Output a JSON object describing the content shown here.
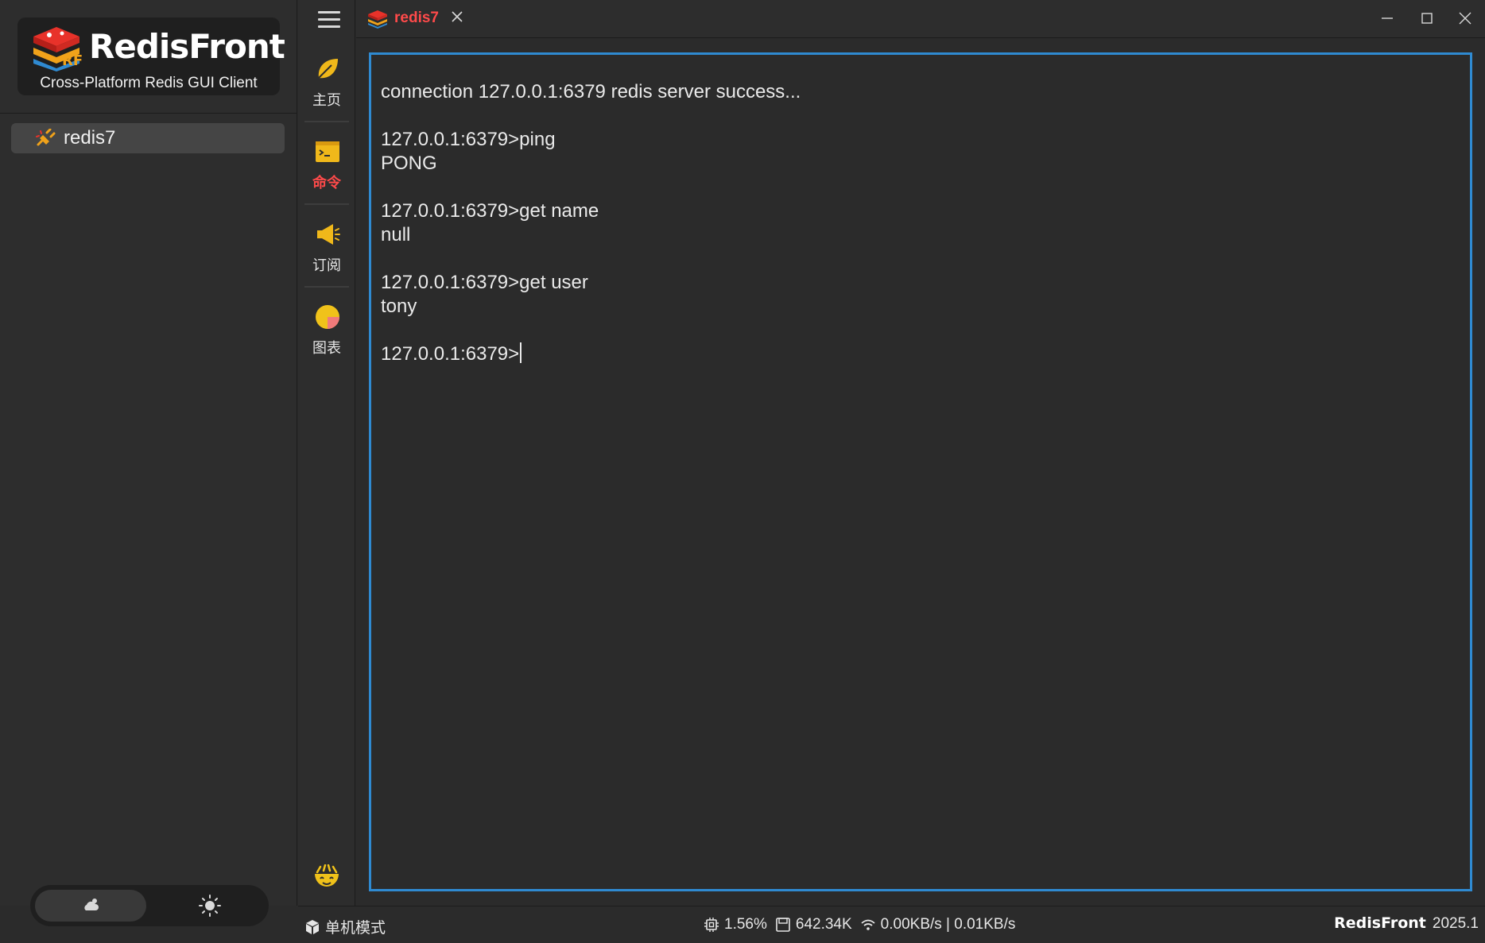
{
  "app": {
    "logo_title": "RedisFront",
    "logo_subtitle": "Cross-Platform Redis GUI Client"
  },
  "connections": [
    {
      "label": "redis7"
    }
  ],
  "nav": {
    "items": [
      {
        "label": "主页",
        "icon": "leaf-icon"
      },
      {
        "label": "命令",
        "icon": "terminal-icon",
        "active": true
      },
      {
        "label": "订阅",
        "icon": "megaphone-icon"
      },
      {
        "label": "图表",
        "icon": "pie-chart-icon"
      }
    ]
  },
  "tabs": [
    {
      "label": "redis7"
    }
  ],
  "terminal": {
    "lines": [
      "connection 127.0.0.1:6379 redis server success...",
      "",
      "127.0.0.1:6379>ping",
      "PONG",
      "",
      "127.0.0.1:6379>get name",
      "null",
      "",
      "127.0.0.1:6379>get user",
      "tony",
      ""
    ],
    "prompt": "127.0.0.1:6379>"
  },
  "statusbar": {
    "mode": "单机模式",
    "cpu": "1.56%",
    "memory": "642.34K",
    "network": "0.00KB/s | 0.01KB/s",
    "brand": "RedisFront",
    "version": "2025.1"
  },
  "colors": {
    "accent_red": "#ff4a4a",
    "terminal_border": "#2f8ad1",
    "background": "#2b2b2b"
  }
}
